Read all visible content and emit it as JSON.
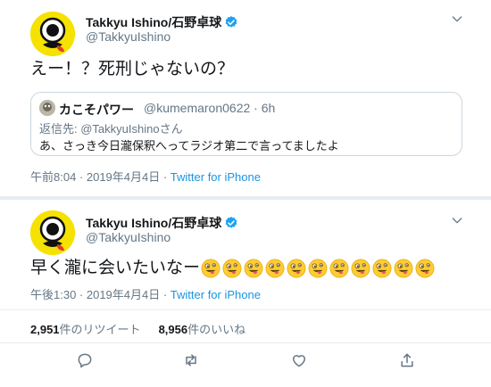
{
  "tweet1": {
    "name": "Takkyu Ishino/石野卓球",
    "handle": "@TakkyuIshino",
    "text": "えー！？死刑じゃないの？",
    "quote": {
      "name": "カこそパワー",
      "handle": "@kumemaron0622 · 6h",
      "reply_prefix": "返信先: ",
      "reply_mention": "@TakkyuIshino",
      "reply_suffix": "さん",
      "text": "あ、さっき今日瀧保釈へってラジオ第二で言ってましたよ"
    },
    "timestamp": "午前8:04 · 2019年4月4日 · ",
    "source": "Twitter for iPhone"
  },
  "tweet2": {
    "name": "Takkyu Ishino/石野卓球",
    "handle": "@TakkyuIshino",
    "text": "早く瀧に会いたいなー",
    "emoji_count": 11,
    "timestamp": "午後1:30 · 2019年4月4日 · ",
    "source": "Twitter for iPhone",
    "retweets_count": "2,951",
    "retweets_label": "件のリツイート",
    "likes_count": "8,956",
    "likes_label": "件のいいね"
  },
  "colors": {
    "accent": "#1da1f2",
    "link": "#1b95e0",
    "muted": "#657786",
    "avatar_bg": "#f5e200"
  },
  "icons": [
    "verified-icon",
    "chevron-down-icon",
    "reply-icon",
    "retweet-icon",
    "like-icon",
    "share-icon",
    "winking-tongue-emoji"
  ]
}
